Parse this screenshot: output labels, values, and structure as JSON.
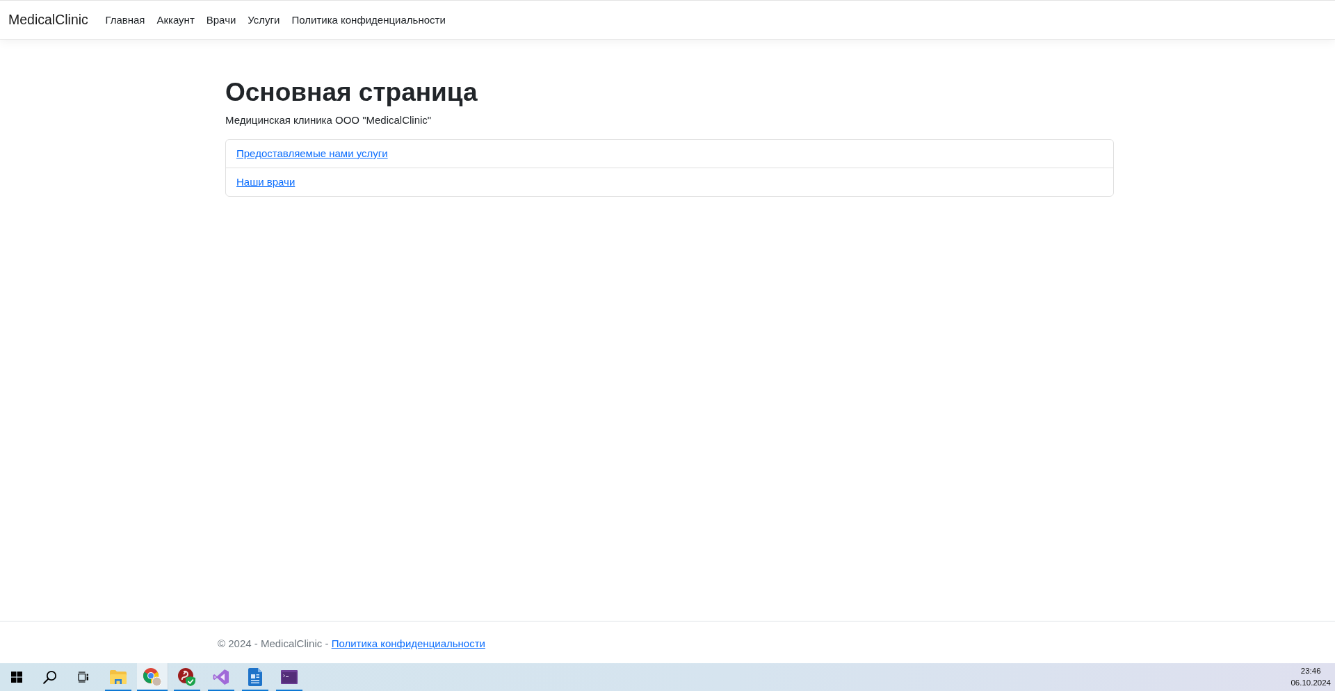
{
  "navbar": {
    "brand": "MedicalClinic",
    "links": [
      "Главная",
      "Аккаунт",
      "Врачи",
      "Услуги",
      "Политика конфиденциальности"
    ]
  },
  "main": {
    "title": "Основная страница",
    "description": "Медицинская клиника ООО \"MedicalClinic\"",
    "links": [
      "Предоставляемые нами услуги",
      "Наши врачи"
    ]
  },
  "footer": {
    "text": "© 2024 - MedicalClinic -",
    "link": "Политика конфиденциальности"
  },
  "taskbar": {
    "apps": [
      {
        "kind": "folder",
        "selected": false,
        "running": true
      },
      {
        "kind": "browser",
        "selected": true,
        "running": true
      },
      {
        "kind": "shield",
        "selected": false,
        "running": true
      },
      {
        "kind": "ribbon",
        "selected": false,
        "running": true
      },
      {
        "kind": "document",
        "selected": false,
        "running": true
      },
      {
        "kind": "terminal",
        "selected": false,
        "running": true
      }
    ],
    "time": "23:46",
    "date": "06.10.2024"
  }
}
